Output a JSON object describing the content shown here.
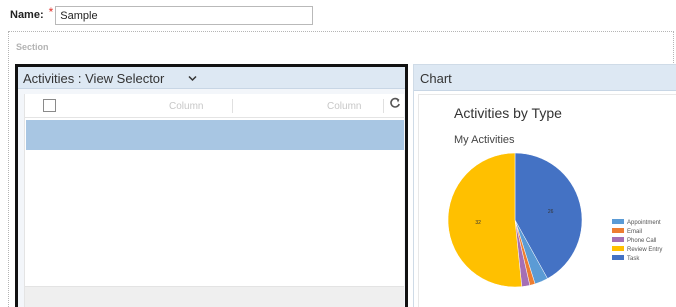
{
  "form": {
    "name_label": "Name:",
    "required_marker": "*",
    "name_value": "Sample"
  },
  "section": {
    "label": "Section"
  },
  "activities": {
    "title": "Activities : View Selector",
    "columns": [
      "Column",
      "Column"
    ]
  },
  "chart_panel": {
    "header": "Chart"
  },
  "chart_data": {
    "type": "pie",
    "title": "Activities by Type",
    "subtitle": "My Activities",
    "categories": [
      "Appointment",
      "Email",
      "Phone Call",
      "Review Entry",
      "Task"
    ],
    "values": [
      2,
      0.8,
      1.2,
      32,
      26
    ],
    "data_labels": [
      "",
      "",
      "",
      "32",
      "26"
    ],
    "colors": [
      "#5b9bd5",
      "#ed7d31",
      "#a56fb5",
      "#ffc000",
      "#4472c4"
    ],
    "legend_position": "right"
  }
}
